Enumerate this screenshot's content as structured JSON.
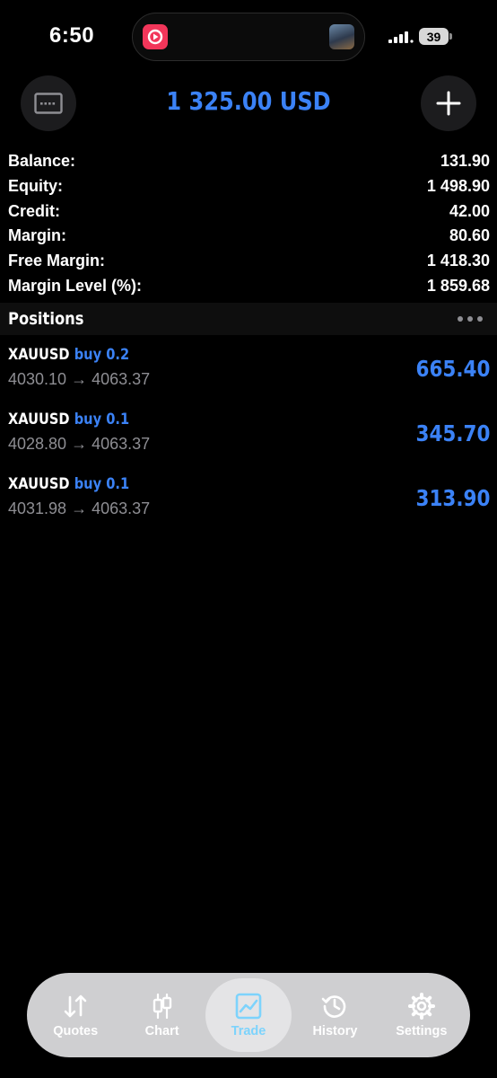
{
  "status_bar": {
    "time": "6:50",
    "battery": "39"
  },
  "header": {
    "title": "1 325.00 USD",
    "left_icon": "card-icon",
    "right_icon": "plus-icon"
  },
  "account": {
    "rows": [
      {
        "label": "Balance:",
        "value": "131.90"
      },
      {
        "label": "Equity:",
        "value": "1 498.90"
      },
      {
        "label": "Credit:",
        "value": "42.00"
      },
      {
        "label": "Margin:",
        "value": "80.60"
      },
      {
        "label": "Free Margin:",
        "value": "1 418.30"
      },
      {
        "label": "Margin Level (%):",
        "value": "1 859.68"
      }
    ]
  },
  "positions": {
    "title": "Positions",
    "items": [
      {
        "symbol": "XAUUSD",
        "side": "buy 0.2",
        "prices": "4030.10 → 4063.37",
        "profit": "665.40"
      },
      {
        "symbol": "XAUUSD",
        "side": "buy 0.1",
        "prices": "4028.80 → 4063.37",
        "profit": "345.70"
      },
      {
        "symbol": "XAUUSD",
        "side": "buy 0.1",
        "prices": "4031.98 → 4063.37",
        "profit": "313.90"
      }
    ]
  },
  "tabs": [
    {
      "label": "Quotes",
      "icon": "arrows-up-down-icon"
    },
    {
      "label": "Chart",
      "icon": "candlestick-icon"
    },
    {
      "label": "Trade",
      "icon": "trade-chart-icon",
      "active": true
    },
    {
      "label": "History",
      "icon": "history-icon"
    },
    {
      "label": "Settings",
      "icon": "gear-icon"
    }
  ],
  "colors": {
    "accent": "#3b82f6",
    "background": "#000000",
    "secondary_text": "#8e8e93",
    "tabbar": "#cfcfd1"
  }
}
